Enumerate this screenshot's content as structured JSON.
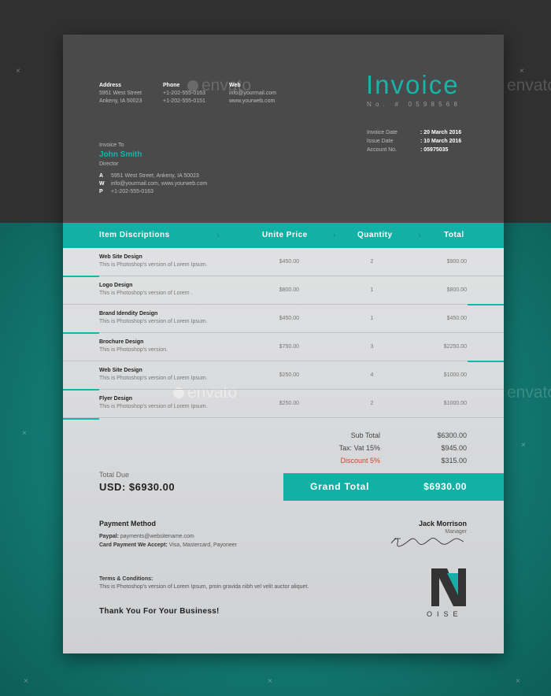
{
  "company": {
    "address_label": "Address",
    "address_lines": [
      "5951 West Street",
      "Ankeny, IA 50023"
    ],
    "phone_label": "Phone",
    "phone_lines": [
      "+1-202-555-0163",
      "+1-202-555-0151"
    ],
    "web_label": "Web",
    "web_lines": [
      "info@yourmail.com",
      "www.yourweb.com"
    ]
  },
  "invoice": {
    "title": "Invoice",
    "number": "No. # 0598568",
    "meta": [
      {
        "label": "Invoice Date",
        "value": ": 20 March 2016"
      },
      {
        "label": "Issue Date",
        "value": ": 10 March 2016"
      },
      {
        "label": "Account No.",
        "value": ": 05975035"
      }
    ]
  },
  "client": {
    "label": "Invoice To",
    "name": "John Smith",
    "role": "Director",
    "contacts": [
      {
        "key": "A",
        "value": "5951 West Street, Ankeny, IA 50023"
      },
      {
        "key": "W",
        "value": "info@yourmail.com, www.yourweb.com"
      },
      {
        "key": "P",
        "value": "+1-202-555-0163"
      }
    ]
  },
  "table": {
    "headers": [
      "Item Discriptions",
      "Unite Price",
      "Quantity",
      "Total"
    ],
    "rows": [
      {
        "name": "Web Site Design",
        "desc": "This is Photoshop's version  of Lorem Ipsum.",
        "price": "$450.00",
        "qty": "2",
        "total": "$900.00"
      },
      {
        "name": "Logo Design",
        "desc": "This is Photoshop's version  of Lorem .",
        "price": "$800.00",
        "qty": "1",
        "total": "$800.00"
      },
      {
        "name": "Brand Idendity Design",
        "desc": "This is Photoshop's version  of Lorem Ipsum.",
        "price": "$450.00",
        "qty": "1",
        "total": "$450.00"
      },
      {
        "name": "Brochure Design",
        "desc": "This is Photoshop's version.",
        "price": "$750.00",
        "qty": "3",
        "total": "$2250.00"
      },
      {
        "name": "Web Site Design",
        "desc": "This is Photoshop's version  of Lorem Ipsum.",
        "price": "$250.00",
        "qty": "4",
        "total": "$1000.00"
      },
      {
        "name": "Flyer Design",
        "desc": "This is Photoshop's version  of Lorem Ipsum.",
        "price": "$250.00",
        "qty": "2",
        "total": "$1000.00"
      }
    ]
  },
  "summary": {
    "subtotal_label": "Sub Total",
    "subtotal": "$6300.00",
    "tax_label": "Tax: Vat 15%",
    "tax": "$945.00",
    "discount_label": "Discount 5%",
    "discount": "$315.00",
    "grand_label": "Grand Total",
    "grand": "$6930.00",
    "due_label": "Total Due",
    "due": "USD: $6930.00"
  },
  "payment": {
    "title": "Payment Method",
    "paypal_label": "Paypal:",
    "paypal": "payments@websitename.com",
    "card_label": "Card Payment We Accept:",
    "card": "Visa, Mastercard, Payoneer"
  },
  "terms": {
    "title": "Terms & Conditions:",
    "text": "This is Photoshop's version  of Lorem Ipsum, proin gravida nibh vel velit auctor aliquet."
  },
  "signer": {
    "name": "Jack Morrison",
    "role": "Manager",
    "signature": "Jackmorrison"
  },
  "thanks": "Thank You For Your Business!",
  "logo": {
    "letter": "N",
    "text": "OISE"
  },
  "watermark": "envato",
  "colors": {
    "accent": "#12b0a5",
    "discount": "#d9412f",
    "dark": "#4a4a4b"
  }
}
